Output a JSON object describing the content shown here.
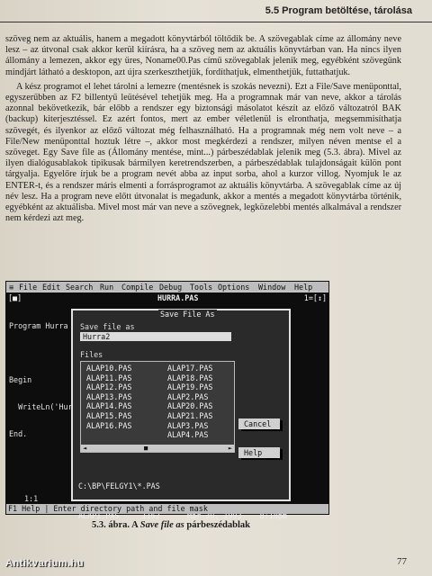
{
  "header": {
    "title": "5.5 Program betöltése, tárolása"
  },
  "paragraphs": {
    "p1": "szöveg nem az aktuális, hanem a megadott könyvtárból töltődik be. A szövegablak címe az állomány neve lesz – az útvonal csak akkor kerül kiírásra, ha a szöveg nem az aktuális könyvtárban van. Ha nincs ilyen állomány a lemezen, akkor egy üres, Noname00.Pas című szövegablak jelenik meg, egyébként szövegünk mindjárt látható a desktopon, azt újra szerkeszthetjük, fordíthatjuk, elmenthetjük, futtathatjuk.",
    "p2": "A kész programot el lehet tárolni a lemezre (mentésnek is szokás nevezni). Ezt a File/Save menüponttal, egyszerűbben az F2 billentyű leütésével tehetjük meg. Ha a programnak már van neve, akkor a tárolás azonnal bekövetkezik, bár előbb a rendszer egy biztonsági másolatot készít az előző változatról BAK (backup) kiterjesztéssel. Ez azért fontos, mert az ember véletlenül is elronthatja, megsemmisíthatja szövegét, és ilyenkor az előző változat még felhasználható. Ha a programnak még nem volt neve – a File/New menüponttal hoztuk létre –, akkor most megkérdezi a rendszer, milyen néven mentse el a szöveget. Egy Save file as (Állomány mentése, mint...) párbeszédablak jelenik meg (5.3. ábra). Mivel az ilyen dialógusablakok tipikusak bármilyen keretrendszerben, a párbeszédablak tulajdonságait külön pont tárgyalja. Egyelőre írjuk be a program nevét abba az input sorba, ahol a kurzor villog. Nyomjuk le az ENTER-t, és a rendszer máris elmenti a forrásprogramot az aktuális könyvtárba. A szövegablak címe az új név lesz. Ha a program neve előtt útvonalat is megadunk, akkor a mentés a megadott könyvtárba történik, egyébként az aktuálisba. Mivel most már van neve a szövegnek, legközelebbi mentés alkalmával a rendszer nem kérdezi azt meg."
  },
  "figure": {
    "menu": [
      "≡",
      "File",
      "Edit",
      "Search",
      "Run",
      "Compile",
      "Debug",
      "Tools",
      "Options",
      "Window",
      "Help"
    ],
    "editor_title": "HURRA.PAS",
    "editor_controls": "1=[↕]",
    "editor_left": "[■]",
    "code_lines": [
      "Program Hurra ;",
      "",
      "Begin",
      "  WriteLn('Hur",
      "End."
    ],
    "dialog_title": "Save File As",
    "save_as_label": "Save file as",
    "save_as_value": "Hurra2",
    "files_label": "Files",
    "files_col1": [
      "ALAP10.PAS",
      "ALAP11.PAS",
      "ALAP12.PAS",
      "ALAP13.PAS",
      "ALAP14.PAS",
      "ALAP15.PAS",
      "ALAP16.PAS"
    ],
    "files_col2": [
      "ALAP17.PAS",
      "ALAP18.PAS",
      "ALAP19.PAS",
      "ALAP2.PAS",
      "ALAP20.PAS",
      "ALAP21.PAS",
      "ALAP3.PAS",
      "ALAP4.PAS"
    ],
    "cancel_label": "Cancel",
    "help_label": "Help",
    "path_line": "C:\\BP\\FELGY1\\*.PAS",
    "file_info": "ALAP1.PAS     1162      Mar 30, 1993    8:18pm",
    "cursor_pos": "1:1",
    "status_line": "F1 Help | Enter directory path and file mask"
  },
  "caption": {
    "number": "5.3. ábra. A",
    "title": "Save file as",
    "rest": "párbeszédablak"
  },
  "page_number": "77",
  "watermark": "Antikvarium.hu"
}
